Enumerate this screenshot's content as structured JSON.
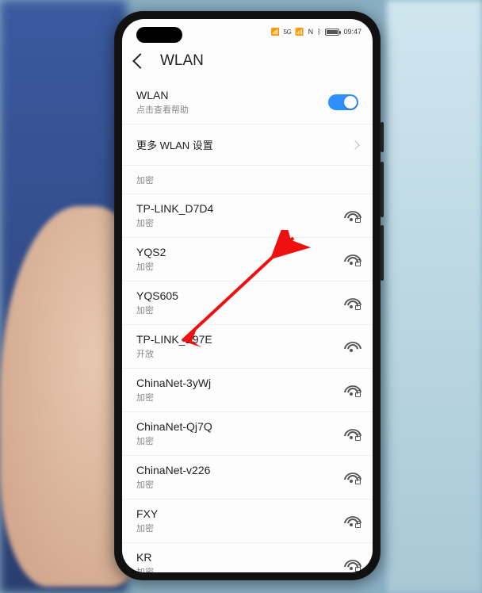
{
  "statusbar": {
    "carrier_extra": "5G",
    "nfc": "N",
    "time": "09:47"
  },
  "header": {
    "title": "WLAN"
  },
  "wlan_toggle": {
    "label": "WLAN",
    "hint": "点击查看帮助",
    "on": true
  },
  "more_settings": {
    "label": "更多 WLAN 设置"
  },
  "partial_top": {
    "security": "加密"
  },
  "networks": [
    {
      "ssid": "TP-LINK_D7D4",
      "security": "加密",
      "locked": true
    },
    {
      "ssid": "YQS2",
      "security": "加密",
      "locked": true
    },
    {
      "ssid": "YQS605",
      "security": "加密",
      "locked": true
    },
    {
      "ssid": "TP-LINK_E97E",
      "security": "开放",
      "locked": false
    },
    {
      "ssid": "ChinaNet-3yWj",
      "security": "加密",
      "locked": true
    },
    {
      "ssid": "ChinaNet-Qj7Q",
      "security": "加密",
      "locked": true
    },
    {
      "ssid": "ChinaNet-v226",
      "security": "加密",
      "locked": true
    },
    {
      "ssid": "FXY",
      "security": "加密",
      "locked": true
    },
    {
      "ssid": "KR",
      "security": "加密",
      "locked": true
    }
  ],
  "annotation": {
    "type": "red-arrow",
    "points_to_network_index": 3
  }
}
